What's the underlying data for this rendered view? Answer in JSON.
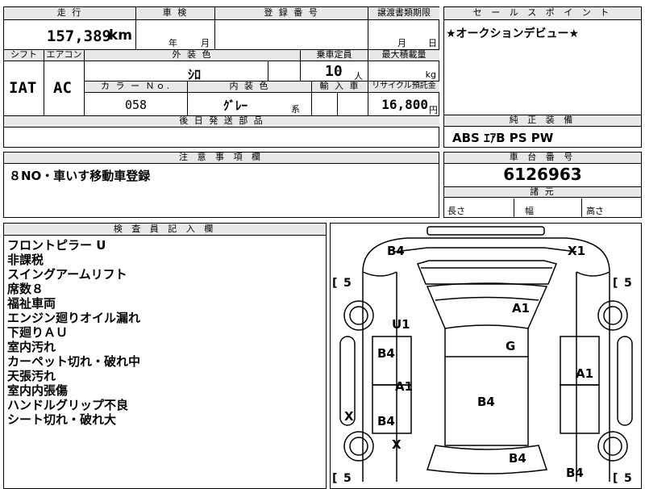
{
  "top": {
    "mileage_header": "走 行",
    "mileage": "157,389",
    "mileage_unit": "km",
    "shaken_header": "車 検",
    "shaken_year": "年",
    "shaken_month": "月",
    "reg_header": "登 録 番 号",
    "transfer_header": "譲渡書類期限",
    "transfer_month": "月",
    "transfer_day": "日",
    "shift_header": "シフト",
    "ac_header": "エアコン",
    "shift": "IAT",
    "ac": "AC",
    "exterior_header": "外 装 色",
    "exterior_color": "ｼﾛ",
    "capacity_header": "乗車定員",
    "capacity": "10",
    "capacity_unit": "人",
    "loadcap_header": "最大積載量",
    "loadcap_unit": "kg",
    "colorno_header": "カ ラ ー Ｎｏ.",
    "colorno": "058",
    "interior_header": "内 装 色",
    "interior_color": "ｸﾞﾚｰ",
    "interior_suffix": "系",
    "import_header": "輸 入 車",
    "recycle_header": "リサイクル預託金",
    "recycle": "16,800",
    "recycle_unit": "円",
    "later_header": "後 日 発 送 部 品"
  },
  "sales": {
    "header": "セ ー ル ス ポ イ ン ト",
    "text": "★オークションデビュー★"
  },
  "equipment": {
    "header": "純 正 装 備",
    "text": "ABS ｴｱB PS PW"
  },
  "notes": {
    "header": "注 意 事 項 欄",
    "text": "８NO・車いす移動車登録"
  },
  "chassis": {
    "header": "車 台 番 号",
    "number": "6126963",
    "dims_header": "諸 元",
    "length": "長さ",
    "width": "幅",
    "height": "高さ"
  },
  "inspector": {
    "header": "検 査 員 記 入 欄",
    "lines": [
      "フロントピラー U",
      "非課税",
      "スイングアームリフト",
      "席数８",
      "福祉車両",
      "エンジン廻りオイル漏れ",
      "下廻りＡＵ",
      "室内汚れ",
      "カーペット切れ・破れ中",
      "天張汚れ",
      "室内内張傷",
      "ハンドルグリップ不良",
      "シート切れ・破れ大"
    ]
  },
  "diagram": {
    "marks": [
      "B4",
      "X1",
      "A1",
      "U1",
      "G",
      "B4",
      "A1",
      "A1",
      "B4",
      "X",
      "B4",
      "X",
      "B4",
      "B4"
    ],
    "tires": [
      "5",
      "5",
      "5",
      "5"
    ]
  }
}
